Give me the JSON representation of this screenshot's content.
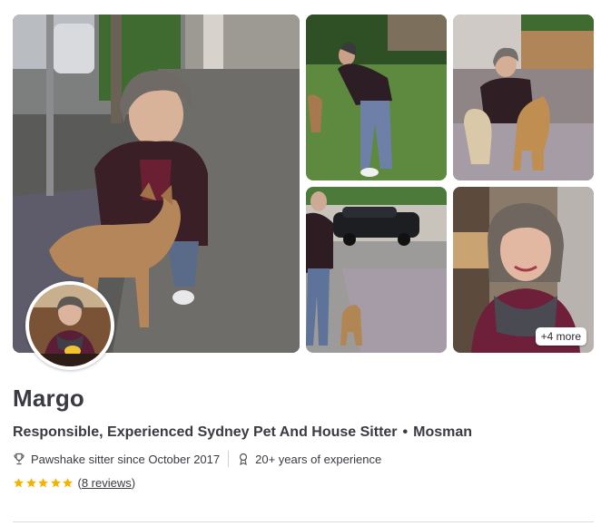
{
  "gallery": {
    "more_badge": "+4 more"
  },
  "profile": {
    "name": "Margo",
    "headline": "Responsible, Experienced Sydney Pet And House Sitter",
    "separator": "•",
    "location": "Mosman",
    "since": "Pawshake sitter since October 2017",
    "experience": "20+ years of experience",
    "rating_stars": 5,
    "reviews_open": "(",
    "reviews_label": "8 reviews",
    "reviews_close": ")"
  },
  "colors": {
    "star": "#f5b301",
    "text": "#3a3a42",
    "divider": "#dcdce0"
  },
  "icons": {
    "since": "trophy-icon",
    "experience": "award-ribbon-icon",
    "rating": "star-icon"
  }
}
